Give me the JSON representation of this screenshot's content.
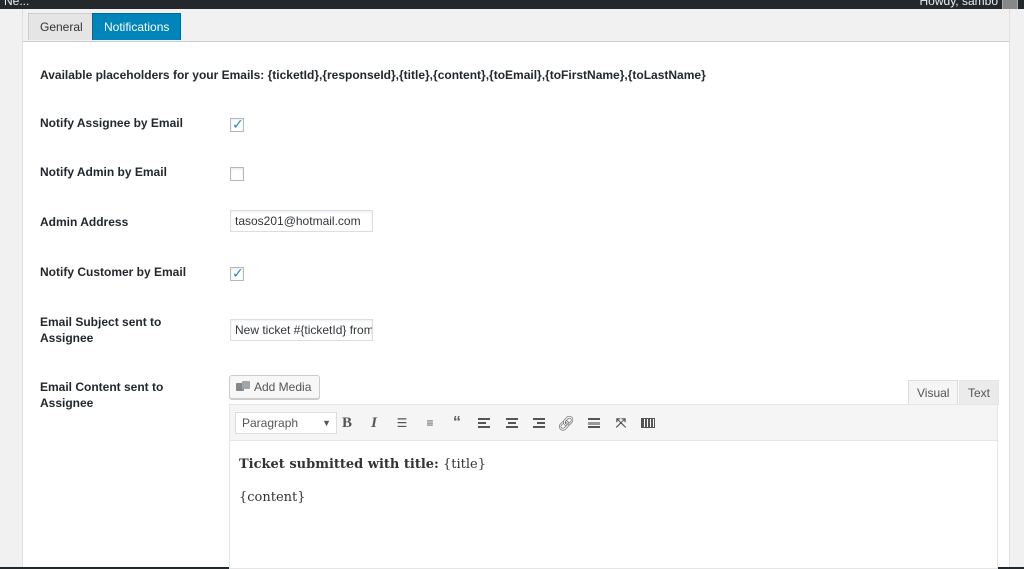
{
  "admin_bar": {
    "site_fragment": "Ne...",
    "greeting": "Howdy, sambo"
  },
  "tabs": [
    {
      "label": "General"
    },
    {
      "label": "Notifications"
    }
  ],
  "placeholders_text": "Available placeholders for your Emails: {ticketId},{responseId},{title},{content},{toEmail},{toFirstName},{toLastName}",
  "fields": {
    "notify_assignee": {
      "label": "Notify Assignee by Email",
      "checked": true
    },
    "notify_admin": {
      "label": "Notify Admin by Email",
      "checked": false
    },
    "admin_address": {
      "label": "Admin Address",
      "value": "tasos201@hotmail.com"
    },
    "notify_customer": {
      "label": "Notify Customer by Email",
      "checked": true
    },
    "email_subject": {
      "label": "Email Subject sent to Assignee",
      "value": "New ticket #{ticketId} from {toFirstName}"
    },
    "email_content": {
      "label": "Email Content sent to Assignee"
    }
  },
  "editor": {
    "add_media_label": "Add Media",
    "tab_visual": "Visual",
    "tab_text": "Text",
    "format_selected": "Paragraph",
    "content_bold": "Ticket submitted with title:",
    "content_title_placeholder": "{title}",
    "content_body_placeholder": "{content}"
  },
  "colors": {
    "accent": "#0085ba",
    "check": "#1e8cbe",
    "admin_bar": "#23282d"
  }
}
